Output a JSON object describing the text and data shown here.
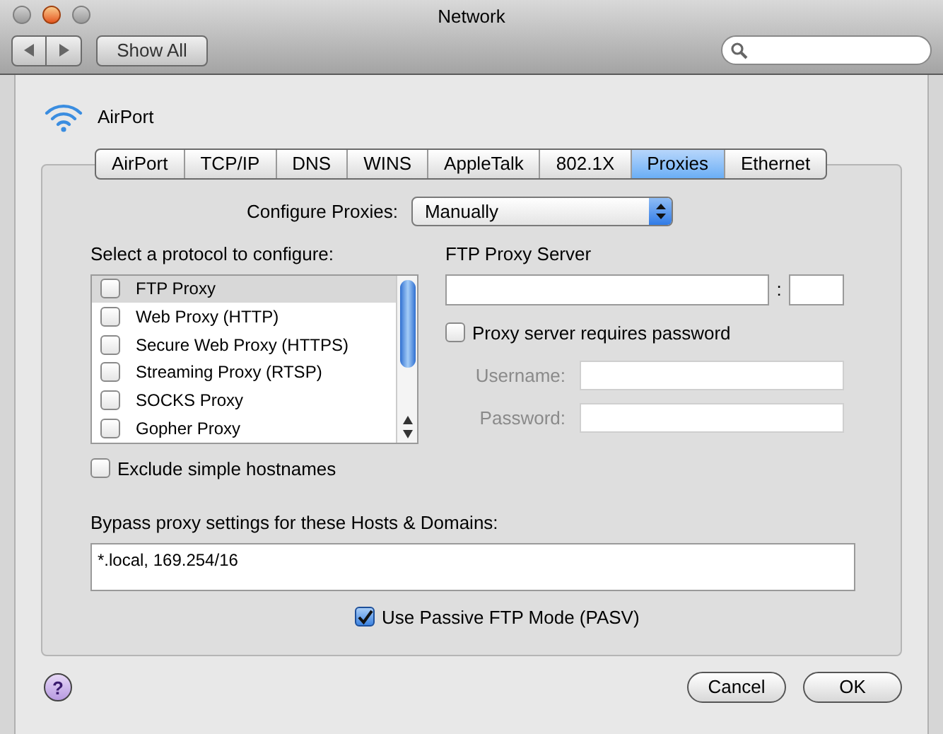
{
  "window": {
    "title": "Network"
  },
  "toolbar": {
    "show_all": "Show All"
  },
  "service": {
    "name": "AirPort"
  },
  "tabs": [
    {
      "label": "AirPort",
      "selected": false
    },
    {
      "label": "TCP/IP",
      "selected": false
    },
    {
      "label": "DNS",
      "selected": false
    },
    {
      "label": "WINS",
      "selected": false
    },
    {
      "label": "AppleTalk",
      "selected": false
    },
    {
      "label": "802.1X",
      "selected": false
    },
    {
      "label": "Proxies",
      "selected": true
    },
    {
      "label": "Ethernet",
      "selected": false
    }
  ],
  "configure": {
    "label": "Configure Proxies:",
    "value": "Manually"
  },
  "protocols": {
    "label": "Select a protocol to configure:",
    "items": [
      {
        "label": "FTP Proxy",
        "checked": false,
        "selected": true
      },
      {
        "label": "Web Proxy (HTTP)",
        "checked": false,
        "selected": false
      },
      {
        "label": "Secure Web Proxy (HTTPS)",
        "checked": false,
        "selected": false
      },
      {
        "label": "Streaming Proxy (RTSP)",
        "checked": false,
        "selected": false
      },
      {
        "label": "SOCKS Proxy",
        "checked": false,
        "selected": false
      },
      {
        "label": "Gopher Proxy",
        "checked": false,
        "selected": false
      }
    ]
  },
  "exclude_simple": {
    "label": "Exclude simple hostnames",
    "checked": false
  },
  "server": {
    "label": "FTP Proxy Server",
    "separator": ":"
  },
  "requires_password": {
    "label": "Proxy server requires password",
    "checked": false
  },
  "credentials": [
    {
      "label": "Username:",
      "disabled": true
    },
    {
      "label": "Password:",
      "disabled": true
    }
  ],
  "bypass": {
    "label": "Bypass proxy settings for these Hosts & Domains:",
    "value": "*.local, 169.254/16"
  },
  "passive": {
    "label": "Use Passive FTP Mode (PASV)",
    "checked": true
  },
  "help": "?",
  "buttons": [
    "Cancel",
    "OK"
  ]
}
